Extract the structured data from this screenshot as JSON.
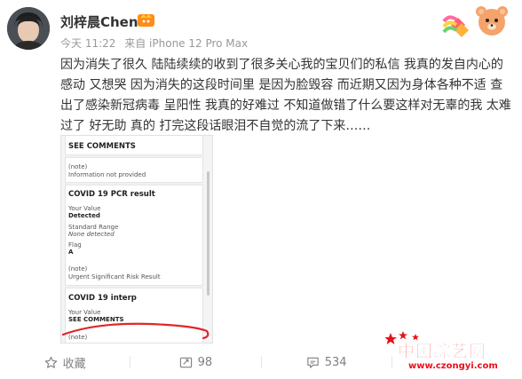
{
  "post": {
    "author": "刘梓晨Chen",
    "time": "今天 11:22",
    "source": "来自 iPhone 12 Pro Max",
    "text": "因为消失了很久 陆陆续续的收到了很多关心我的宝贝们的私信 我真的发自内心的感动 又想哭 因为消失的这段时间里 是因为脸毁容 而近期又因为身体各种不适 查出了感染新冠病毒 呈阳性 我真的好难过 不知道做错了什么要这样对无辜的我 太难过了 好无助 真的 打完这段话眼泪不自觉的流了下来……"
  },
  "screenshot": {
    "see_comments_1": "SEE COMMENTS",
    "note_label_1": "(note)",
    "note_value_1": "Information not provided",
    "test_title": "COVID 19 PCR result",
    "your_value_label_1": "Your Value",
    "your_value_1": "Detected",
    "standard_range_label": "Standard Range",
    "standard_range_value": "None detected",
    "flag_label": "Flag",
    "flag_value": "A",
    "note_label_2": "(note)",
    "note_value_2": "Urgent Significant Risk Result",
    "interp_title": "COVID 19 interp",
    "your_value_label_2": "Your Value",
    "see_comments_2": "SEE COMMENTS",
    "note_label_3": "(note)"
  },
  "actions": {
    "favorite": "收藏",
    "repost": "98",
    "comment": "534"
  },
  "watermark": {
    "main": "中国综艺网",
    "url": "www.czongyi.com"
  },
  "colors": {
    "watermark_red": "#e8101a",
    "annotation_red": "#e0262b",
    "meta_gray": "#999999"
  },
  "icons": [
    "vip-badge-icon",
    "bear-decoration-icon",
    "favorite-icon",
    "repost-icon",
    "comment-icon"
  ]
}
